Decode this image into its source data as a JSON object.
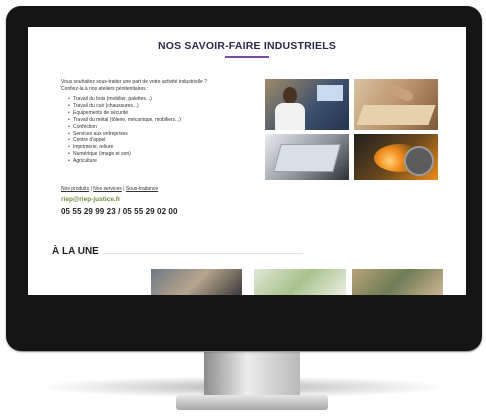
{
  "page": {
    "title": "NOS SAVOIR-FAIRE INDUSTRIELS",
    "intro_line1": "Vous souhaitez sous-traiter une part de votre activité industrielle ?",
    "intro_line2": "Confiez-la à nos ateliers pénitentiaires :",
    "services": [
      "Travail du bois (mobilier, palettes...)",
      "Travail du cuir (chaussures...)",
      "Equipements de sécurité",
      "Travail du métal (tôlerie, mécanique, mobiliers...)",
      "Confection",
      "Services aux entreprises",
      "Centre d'appel",
      "Imprimerie, reliure",
      "Numérique (image et son)",
      "Agriculture"
    ],
    "links": {
      "produits": "Nos produits",
      "services": "Nos services",
      "soustraitance": "Sous-traitance",
      "separator": "|"
    },
    "email": "riep@riep-justice.fr",
    "phones": "05 55 29 99 23 / 05 55 29 02 00",
    "une_title": "À LA UNE"
  },
  "colors": {
    "accent_purple": "#7b4fa0",
    "email_green": "#6b8f3a",
    "title_navy": "#2b2b4a"
  }
}
